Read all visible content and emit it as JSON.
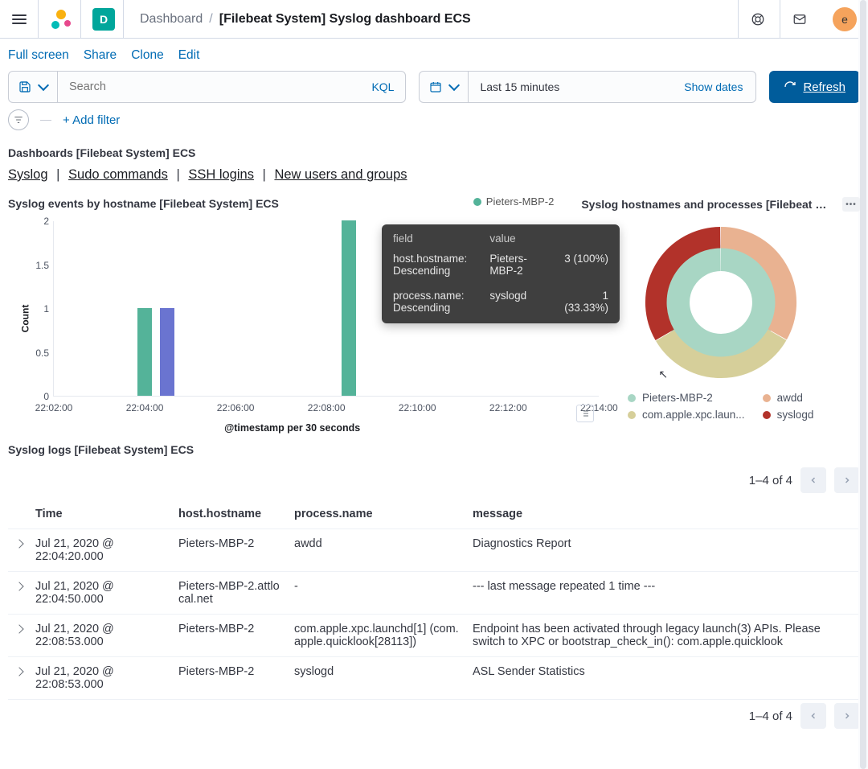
{
  "header": {
    "breadcrumb_app": "Dashboard",
    "breadcrumb_title": "[Filebeat System] Syslog dashboard ECS",
    "chip": "D",
    "avatar": "e"
  },
  "topmenu": {
    "fullscreen": "Full screen",
    "share": "Share",
    "clone": "Clone",
    "edit": "Edit"
  },
  "query": {
    "search_placeholder": "Search",
    "kql": "KQL",
    "date_range": "Last 15 minutes",
    "show_dates": "Show dates",
    "refresh": "Refresh"
  },
  "filters": {
    "add_filter": "+ Add filter"
  },
  "section": {
    "title": "Dashboards [Filebeat System] ECS"
  },
  "navlinks": {
    "syslog": "Syslog",
    "sudo": "Sudo commands",
    "ssh": "SSH logins",
    "users": "New users and groups"
  },
  "panel_bar": {
    "title": "Syslog events by hostname [Filebeat System] ECS",
    "legend": "Pieters-MBP-2",
    "y_label": "Count",
    "x_label": "@timestamp per 30 seconds"
  },
  "panel_donut": {
    "title": "Syslog hostnames and processes [Filebeat System] …"
  },
  "chart_data": [
    {
      "id": "bar",
      "type": "bar",
      "title": "Syslog events by hostname [Filebeat System] ECS",
      "xlabel": "@timestamp per 30 seconds",
      "ylabel": "Count",
      "ylim": [
        0,
        2
      ],
      "yticks": [
        0,
        0.5,
        1,
        1.5,
        2
      ],
      "xticks": [
        "22:02:00",
        "22:04:00",
        "22:06:00",
        "22:08:00",
        "22:10:00",
        "22:12:00",
        "22:14:00"
      ],
      "series": [
        {
          "name": "Pieters-MBP-2",
          "color": "#54b399",
          "bars": [
            {
              "x": "22:04:00",
              "y": 1
            },
            {
              "x": "22:08:30",
              "y": 2
            }
          ]
        },
        {
          "name": "Pieters-MBP-2.attlocal.net",
          "color": "#6a74d0",
          "bars": [
            {
              "x": "22:04:30",
              "y": 1
            }
          ]
        }
      ]
    },
    {
      "id": "donut",
      "type": "pie",
      "title": "Syslog hostnames and processes [Filebeat System] ECS",
      "rings": [
        {
          "field": "host.hostname",
          "slices": [
            {
              "name": "Pieters-MBP-2",
              "value": 3,
              "pct": 100,
              "color": "#a8d6c4"
            }
          ]
        },
        {
          "field": "process.name",
          "slices": [
            {
              "name": "awdd",
              "value": 1,
              "pct": 33.33,
              "color": "#e9b291"
            },
            {
              "name": "com.apple.xpc.launchd",
              "value": 1,
              "pct": 33.33,
              "color": "#d6cf9a"
            },
            {
              "name": "syslogd",
              "value": 1,
              "pct": 33.33,
              "color": "#b2322a"
            }
          ]
        }
      ],
      "legend": [
        {
          "name": "Pieters-MBP-2",
          "color": "#a8d6c4"
        },
        {
          "name": "awdd",
          "color": "#e9b291"
        },
        {
          "name": "com.apple.xpc.laun...",
          "color": "#d6cf9a"
        },
        {
          "name": "syslogd",
          "color": "#b2322a"
        }
      ]
    }
  ],
  "tooltip": {
    "field_h": "field",
    "value_h": "value",
    "rows": [
      {
        "field_l1": "host.hostname:",
        "field_l2": "Descending",
        "v1": "Pieters-MBP-2",
        "v2": "3 (100%)"
      },
      {
        "field_l1": "process.name:",
        "field_l2": "Descending",
        "v1": "syslogd",
        "v2": "1 (33.33%)"
      }
    ]
  },
  "logs": {
    "title": "Syslog logs [Filebeat System] ECS",
    "page_text": "1–4 of 4",
    "columns": {
      "time": "Time",
      "host": "host.hostname",
      "proc": "process.name",
      "msg": "message"
    },
    "rows": [
      {
        "time": "Jul 21, 2020 @ 22:04:20.000",
        "host": "Pieters-MBP-2",
        "proc": "awdd",
        "msg": "Diagnostics Report"
      },
      {
        "time": "Jul 21, 2020 @ 22:04:50.000",
        "host": "Pieters-MBP-2.attlocal.net",
        "proc": "-",
        "msg": "--- last message repeated 1 time ---"
      },
      {
        "time": "Jul 21, 2020 @ 22:08:53.000",
        "host": "Pieters-MBP-2",
        "proc": "com.apple.xpc.launchd[1] (com.apple.quicklook[28113])",
        "msg": "Endpoint has been activated through legacy launch(3) APIs. Please switch to XPC or bootstrap_check_in(): com.apple.quicklook"
      },
      {
        "time": "Jul 21, 2020 @ 22:08:53.000",
        "host": "Pieters-MBP-2",
        "proc": "syslogd",
        "msg": "ASL Sender Statistics"
      }
    ]
  }
}
